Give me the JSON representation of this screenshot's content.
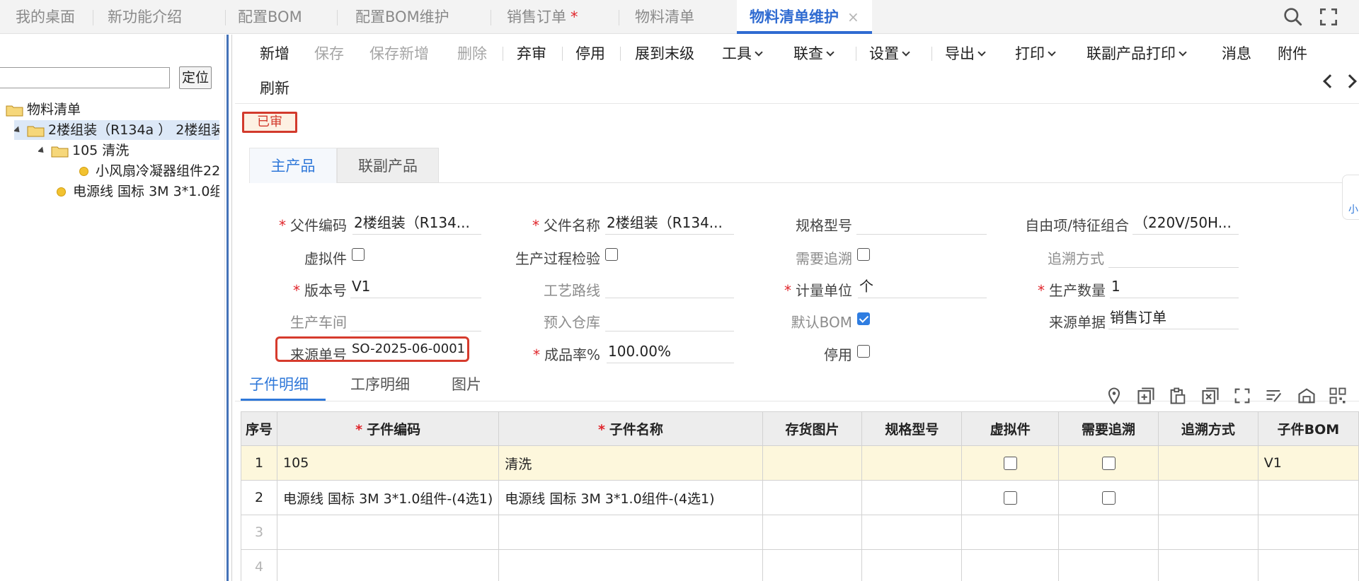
{
  "tabs": [
    {
      "label": "我的桌面"
    },
    {
      "label": "新功能介绍"
    },
    {
      "label": "配置BOM"
    },
    {
      "label": "配置BOM维护"
    },
    {
      "label": "销售订单",
      "star": "*"
    },
    {
      "label": "物料清单"
    },
    {
      "label": "物料清单维护",
      "close": "×",
      "active": true
    }
  ],
  "tree": {
    "search_value": "",
    "locate_label": "定位",
    "nodes": [
      {
        "label": "物料清单"
      },
      {
        "label": "2楼组装（R134a ） 2楼组装"
      },
      {
        "label": "105 清洗"
      },
      {
        "label": "小风扇冷凝器组件22"
      },
      {
        "label": "电源线 国标 3M 3*1.0组"
      }
    ]
  },
  "toolbar": {
    "buttons": [
      {
        "label": "新增"
      },
      {
        "label": "保存"
      },
      {
        "label": "保存新增"
      },
      {
        "label": "删除"
      },
      {
        "label": "弃审"
      },
      {
        "label": "停用"
      },
      {
        "label": "展到末级"
      },
      {
        "label": "工具"
      },
      {
        "label": "联查"
      },
      {
        "label": "设置"
      },
      {
        "label": "导出"
      },
      {
        "label": "打印"
      },
      {
        "label": "联副产品打印"
      },
      {
        "label": "消息"
      },
      {
        "label": "附件"
      },
      {
        "label": "刷新"
      }
    ]
  },
  "status": "已审",
  "product_tabs": [
    "主产品",
    "联副产品"
  ],
  "form": {
    "parent_code": {
      "label": "父件编码",
      "value": "2楼组装（R134..."
    },
    "parent_name": {
      "label": "父件名称",
      "value": "2楼组装（R134..."
    },
    "spec": {
      "label": "规格型号",
      "value": ""
    },
    "free_item": {
      "label": "自由项/特征组合",
      "value": "（220V/50H..."
    },
    "virtual": {
      "label": "虚拟件",
      "checked": false
    },
    "process_check": {
      "label": "生产过程检验",
      "checked": false
    },
    "need_trace": {
      "label": "需要追溯",
      "checked": false
    },
    "trace_method": {
      "label": "追溯方式",
      "value": ""
    },
    "version": {
      "label": "版本号",
      "value": "V1"
    },
    "route": {
      "label": "工艺路线",
      "value": ""
    },
    "unit": {
      "label": "计量单位",
      "value": "个"
    },
    "prod_qty": {
      "label": "生产数量",
      "value": "1"
    },
    "workshop": {
      "label": "生产车间",
      "value": ""
    },
    "warehouse": {
      "label": "预入仓库",
      "value": ""
    },
    "default_bom": {
      "label": "默认BOM",
      "checked": true
    },
    "source_doc": {
      "label": "来源单据",
      "value": "销售订单"
    },
    "source_no": {
      "label": "来源单号",
      "value": "SO-2025-06-0001"
    },
    "yield_rate": {
      "label": "成品率%",
      "value": "100.00%"
    },
    "disabled": {
      "label": "停用",
      "checked": false
    }
  },
  "detail_tabs": [
    "子件明细",
    "工序明细",
    "图片"
  ],
  "grid": {
    "columns": [
      "序号",
      "子件编码",
      "子件名称",
      "存货图片",
      "规格型号",
      "虚拟件",
      "需要追溯",
      "追溯方式",
      "子件BOM"
    ],
    "rows": [
      {
        "no": "1",
        "code": "105",
        "name": "清洗",
        "img": "",
        "spec": "",
        "trace": "",
        "bom": "V1"
      },
      {
        "no": "2",
        "code": "电源线 国标 3M 3*1.0组件-(4选1)",
        "name": "电源线  国标 3M 3*1.0组件-(4选1)",
        "img": "",
        "spec": "",
        "trace": "",
        "bom": ""
      },
      {
        "no": "3",
        "code": "",
        "name": "",
        "img": "",
        "spec": "",
        "trace": "",
        "bom": ""
      },
      {
        "no": "4",
        "code": "",
        "name": "",
        "img": "",
        "spec": "",
        "trace": "",
        "bom": ""
      }
    ]
  },
  "side_float_label": "小",
  "colors": {
    "accent": "#2f6bd1",
    "required": "#e0252b",
    "highlight_row": "#fdf7dc",
    "status_border": "#d23a2c"
  }
}
